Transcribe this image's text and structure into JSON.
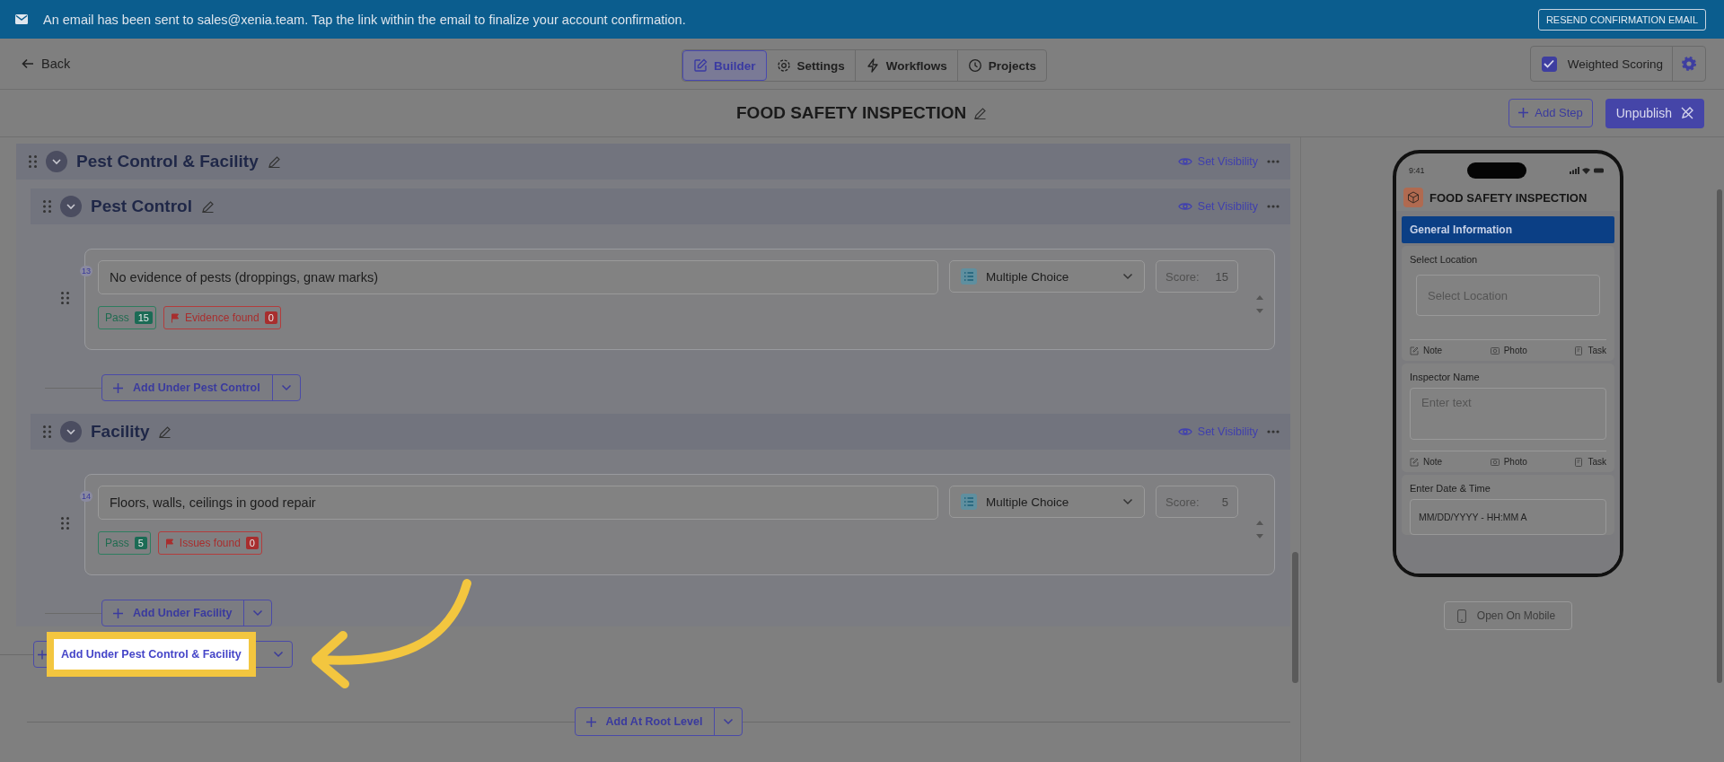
{
  "banner": {
    "text": "An email has been sent to sales@xenia.team. Tap the link within the email to finalize your account confirmation.",
    "button": "RESEND CONFIRMATION EMAIL"
  },
  "nav": {
    "back": "Back",
    "tabs": [
      {
        "label": "Builder",
        "selected": true
      },
      {
        "label": "Settings",
        "selected": false
      },
      {
        "label": "Workflows",
        "selected": false
      },
      {
        "label": "Projects",
        "selected": false
      }
    ],
    "weighted_scoring": {
      "label": "Weighted Scoring",
      "checked": true
    }
  },
  "title_bar": {
    "title": "FOOD SAFETY INSPECTION",
    "add_step": "Add Step",
    "unpublish": "Unpublish"
  },
  "sections": [
    {
      "title": "Pest Control & Facility",
      "visibility": "Set Visibility",
      "add_button": {
        "label": "Add Under Pest Control & Facility",
        "highlighted": true
      },
      "subsections": [
        {
          "title": "Pest Control",
          "visibility": "Set Visibility",
          "add_button": "Add Under Pest Control",
          "questions": [
            {
              "number": "13",
              "text": "No evidence of pests (droppings, gnaw marks)",
              "type": "Multiple Choice",
              "score_label": "Score:",
              "score": "15",
              "responses": [
                {
                  "kind": "pass",
                  "label": "Pass",
                  "count": "15"
                },
                {
                  "kind": "flag",
                  "label": "Evidence found",
                  "count": "0"
                }
              ]
            }
          ]
        },
        {
          "title": "Facility",
          "visibility": "Set Visibility",
          "add_button": "Add Under Facility",
          "questions": [
            {
              "number": "14",
              "text": "Floors, walls, ceilings in good repair",
              "type": "Multiple Choice",
              "score_label": "Score:",
              "score": "5",
              "responses": [
                {
                  "kind": "pass",
                  "label": "Pass",
                  "count": "5"
                },
                {
                  "kind": "flag",
                  "label": "Issues found",
                  "count": "0"
                }
              ]
            }
          ]
        }
      ]
    }
  ],
  "root_add_button": "Add At Root Level",
  "preview": {
    "time": "9:41",
    "title": "FOOD SAFETY INSPECTION",
    "section_title": "General Information",
    "fields": [
      {
        "kind": "select",
        "label": "Select Location",
        "placeholder": "Select Location",
        "actions": [
          "Note",
          "Photo",
          "Task"
        ]
      },
      {
        "kind": "text",
        "label": "Inspector Name",
        "placeholder": "Enter text",
        "actions": [
          "Note",
          "Photo",
          "Task"
        ]
      },
      {
        "kind": "datetime",
        "label": "Enter Date & Time",
        "placeholder": "MM/DD/YYYY - HH:MM A"
      }
    ],
    "open_mobile": "Open On Mobile"
  }
}
